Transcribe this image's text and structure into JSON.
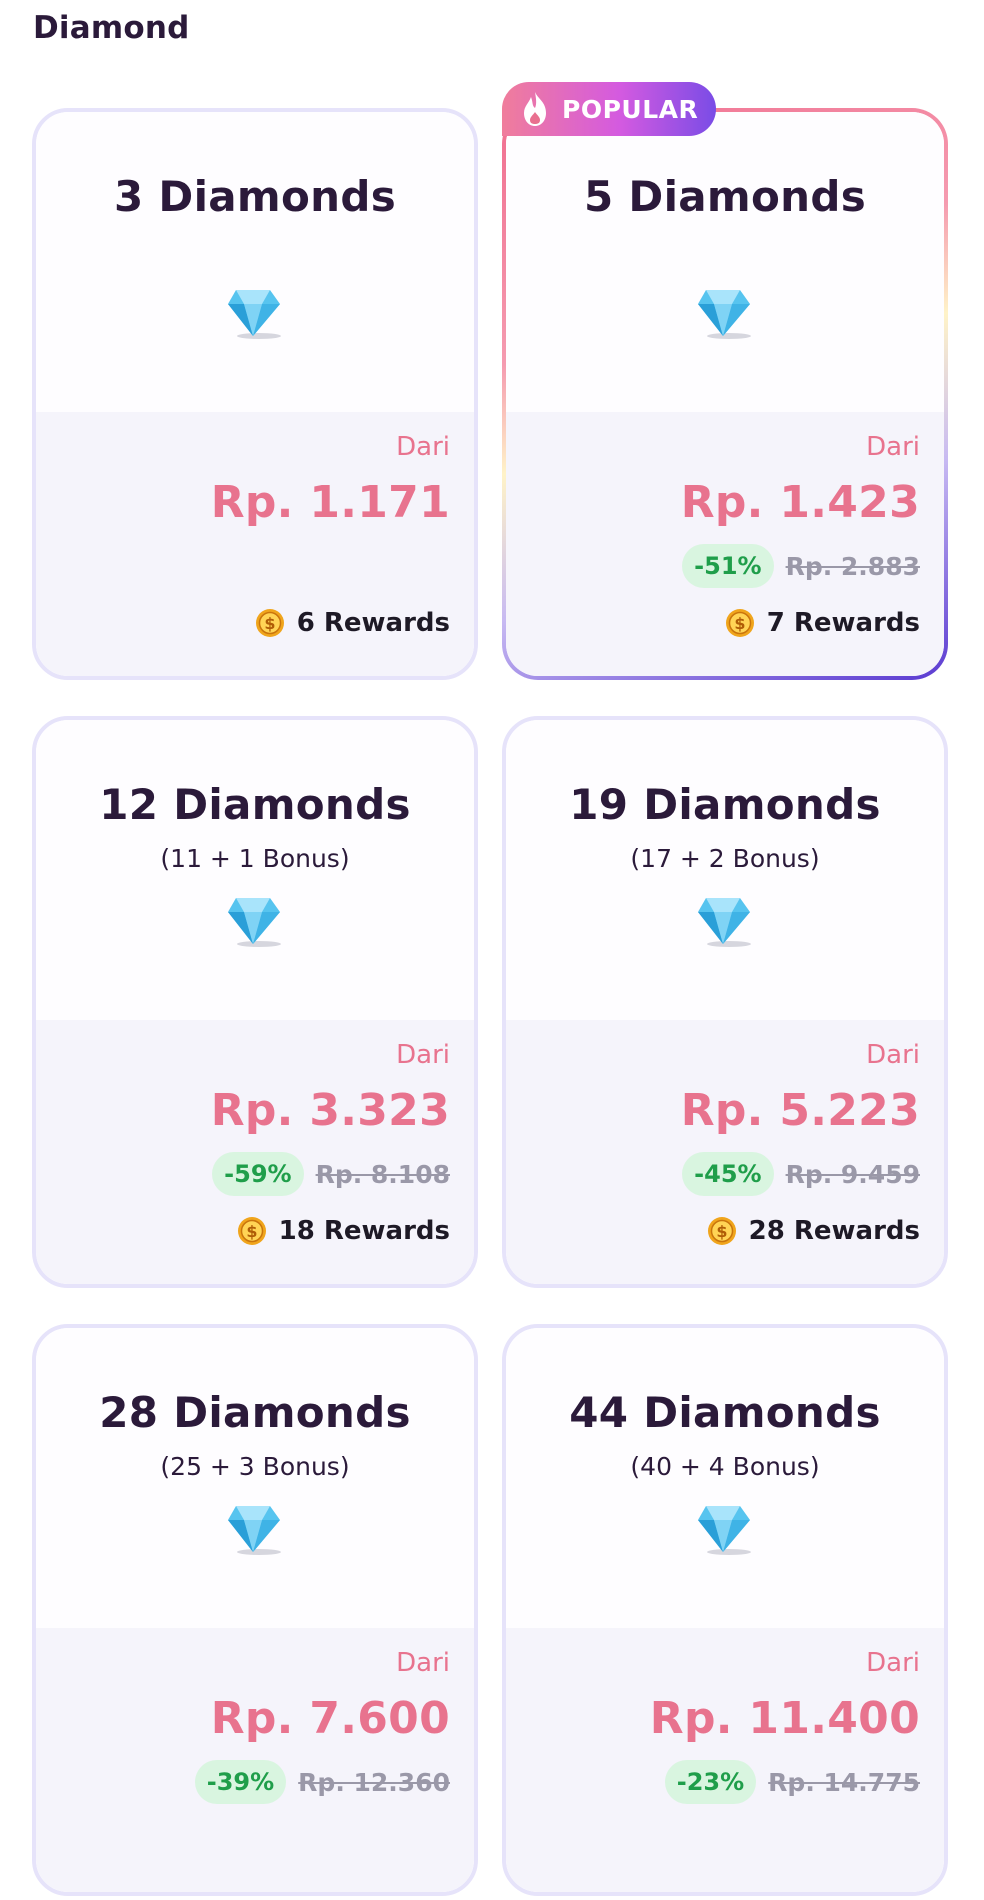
{
  "section": {
    "title": "Diamond"
  },
  "colors": {
    "price": "#e8738e",
    "discount_bg": "#d9f5e0",
    "discount_text": "#1f9e4a",
    "card_border": "#e6e3fa",
    "title": "#2b1a3a"
  },
  "icons": {
    "gem": "diamond-icon",
    "coin": "coin-icon",
    "popular": "flame-icon"
  },
  "popular_label": "POPULAR",
  "cards": [
    {
      "title": "3 Diamonds",
      "bonus": "",
      "dari": "Dari",
      "price": "Rp. 1.171",
      "discount": "",
      "old_price": "",
      "rewards": "6 Rewards",
      "popular": false
    },
    {
      "title": "5 Diamonds",
      "bonus": "",
      "dari": "Dari",
      "price": "Rp. 1.423",
      "discount": "-51%",
      "old_price": "Rp. 2.883",
      "rewards": "7 Rewards",
      "popular": true
    },
    {
      "title": "12 Diamonds",
      "bonus": "(11 + 1 Bonus)",
      "dari": "Dari",
      "price": "Rp. 3.323",
      "discount": "-59%",
      "old_price": "Rp. 8.108",
      "rewards": "18 Rewards",
      "popular": false
    },
    {
      "title": "19 Diamonds",
      "bonus": "(17 + 2 Bonus)",
      "dari": "Dari",
      "price": "Rp. 5.223",
      "discount": "-45%",
      "old_price": "Rp. 9.459",
      "rewards": "28 Rewards",
      "popular": false
    },
    {
      "title": "28 Diamonds",
      "bonus": "(25 + 3 Bonus)",
      "dari": "Dari",
      "price": "Rp. 7.600",
      "discount": "-39%",
      "old_price": "Rp. 12.360",
      "rewards": "",
      "popular": false
    },
    {
      "title": "44 Diamonds",
      "bonus": "(40 + 4 Bonus)",
      "dari": "Dari",
      "price": "Rp. 11.400",
      "discount": "-23%",
      "old_price": "Rp. 14.775",
      "rewards": "",
      "popular": false
    }
  ]
}
